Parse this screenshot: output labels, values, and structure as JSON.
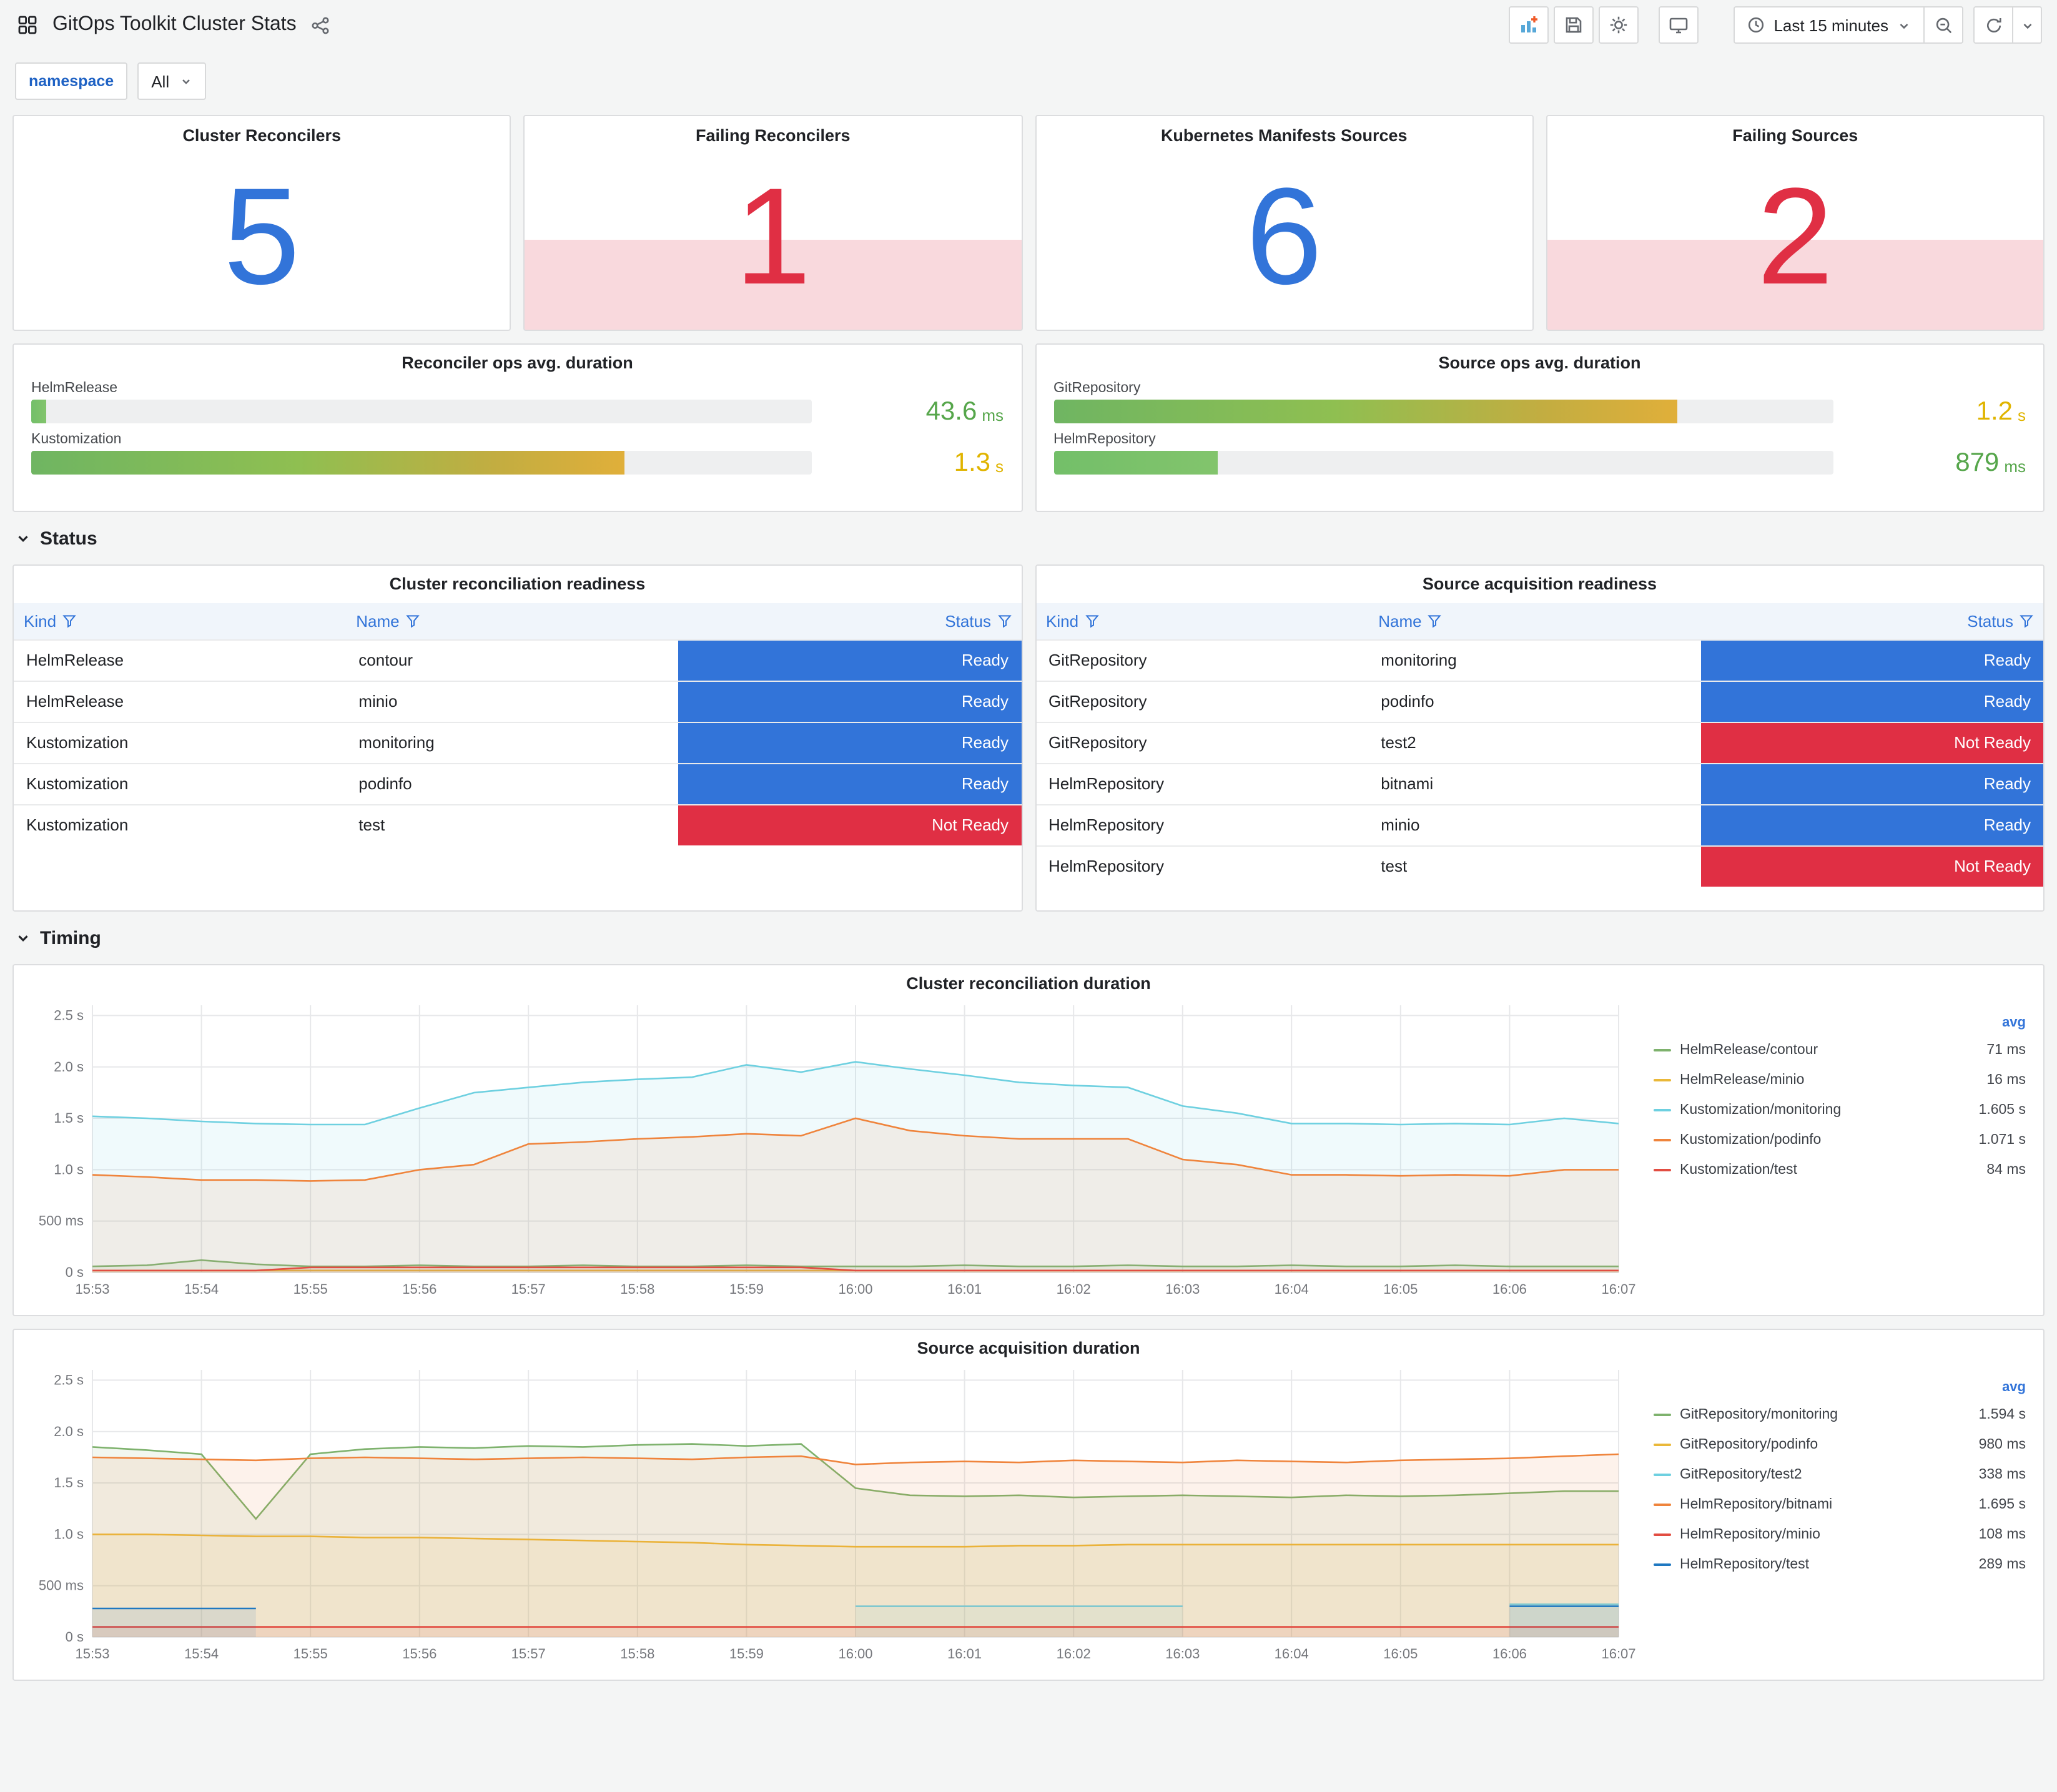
{
  "header": {
    "title": "GitOps Toolkit Cluster Stats",
    "time_picker": "Last 15 minutes"
  },
  "variables": {
    "label": "namespace",
    "value": "All"
  },
  "icons": [
    "dashboard-grid",
    "share",
    "add-panel",
    "save",
    "settings-gear",
    "cycle-view",
    "clock",
    "caret-down",
    "zoom-out",
    "refresh",
    "filter-funnel",
    "chevron-down"
  ],
  "colors": {
    "accent_blue": "#3274D9",
    "alert_red": "#E02F44",
    "value_green": "#56A64B",
    "value_yellow": "#E0B400"
  },
  "stat_panels": [
    {
      "title": "Cluster Reconcilers",
      "value": "5",
      "failing": false
    },
    {
      "title": "Failing Reconcilers",
      "value": "1",
      "failing": true
    },
    {
      "title": "Kubernetes Manifests Sources",
      "value": "6",
      "failing": false
    },
    {
      "title": "Failing Sources",
      "value": "2",
      "failing": true
    }
  ],
  "gauge_panels": [
    {
      "title": "Reconciler ops avg. duration",
      "rows": [
        {
          "label": "HelmRelease",
          "value": "43.6",
          "unit": "ms",
          "percent": 2,
          "fill": "green",
          "value_color": "#56A64B"
        },
        {
          "label": "Kustomization",
          "value": "1.3",
          "unit": "s",
          "percent": 76,
          "fill": "gradient",
          "value_color": "#E0B400"
        }
      ]
    },
    {
      "title": "Source ops avg. duration",
      "rows": [
        {
          "label": "GitRepository",
          "value": "1.2",
          "unit": "s",
          "percent": 80,
          "fill": "gradient",
          "value_color": "#E0B400"
        },
        {
          "label": "HelmRepository",
          "value": "879",
          "unit": "ms",
          "percent": 21,
          "fill": "green",
          "value_color": "#56A64B"
        }
      ]
    }
  ],
  "sections": [
    {
      "title": "Status"
    },
    {
      "title": "Timing"
    }
  ],
  "table_panels": [
    {
      "title": "Cluster reconciliation readiness",
      "columns": [
        "Kind",
        "Name",
        "Status"
      ],
      "rows": [
        [
          "HelmRelease",
          "contour",
          "Ready"
        ],
        [
          "HelmRelease",
          "minio",
          "Ready"
        ],
        [
          "Kustomization",
          "monitoring",
          "Ready"
        ],
        [
          "Kustomization",
          "podinfo",
          "Ready"
        ],
        [
          "Kustomization",
          "test",
          "Not Ready"
        ]
      ]
    },
    {
      "title": "Source acquisition readiness",
      "columns": [
        "Kind",
        "Name",
        "Status"
      ],
      "rows": [
        [
          "GitRepository",
          "monitoring",
          "Ready"
        ],
        [
          "GitRepository",
          "podinfo",
          "Ready"
        ],
        [
          "GitRepository",
          "test2",
          "Not Ready"
        ],
        [
          "HelmRepository",
          "bitnami",
          "Ready"
        ],
        [
          "HelmRepository",
          "minio",
          "Ready"
        ],
        [
          "HelmRepository",
          "test",
          "Not Ready"
        ]
      ]
    }
  ],
  "chart_data": [
    {
      "type": "line",
      "title": "Cluster reconciliation duration",
      "legend_header": "avg",
      "ylim": [
        0,
        2.6
      ],
      "yticks": [
        {
          "v": 0,
          "label": "0 s"
        },
        {
          "v": 0.5,
          "label": "500 ms"
        },
        {
          "v": 1,
          "label": "1.0 s"
        },
        {
          "v": 1.5,
          "label": "1.5 s"
        },
        {
          "v": 2,
          "label": "2.0 s"
        },
        {
          "v": 2.5,
          "label": "2.5 s"
        }
      ],
      "xticks": [
        "15:53",
        "15:54",
        "15:55",
        "15:56",
        "15:57",
        "15:58",
        "15:59",
        "16:00",
        "16:01",
        "16:02",
        "16:03",
        "16:04",
        "16:05",
        "16:06",
        "16:07"
      ],
      "points_per_minute": 2,
      "series": [
        {
          "name": "HelmRelease/contour",
          "color": "#7EB26D",
          "avg": "71 ms",
          "values": [
            0.06,
            0.07,
            0.12,
            0.08,
            0.06,
            0.06,
            0.07,
            0.06,
            0.06,
            0.07,
            0.06,
            0.06,
            0.07,
            0.06,
            0.06,
            0.06,
            0.07,
            0.06,
            0.06,
            0.07,
            0.06,
            0.06,
            0.07,
            0.06,
            0.06,
            0.07,
            0.06,
            0.06,
            0.06
          ]
        },
        {
          "name": "HelmRelease/minio",
          "color": "#EAB839",
          "avg": "16 ms",
          "values": [
            0.02,
            0.02,
            0.02,
            0.02,
            0.02,
            0.02,
            0.02,
            0.02,
            0.02,
            0.02,
            0.02,
            0.02,
            0.02,
            0.02,
            0.02,
            0.02,
            0.02,
            0.02,
            0.02,
            0.02,
            0.02,
            0.02,
            0.02,
            0.02,
            0.02,
            0.02,
            0.02,
            0.02,
            0.02
          ]
        },
        {
          "name": "Kustomization/monitoring",
          "color": "#6ED0E0",
          "avg": "1.605 s",
          "values": [
            1.52,
            1.5,
            1.47,
            1.45,
            1.44,
            1.44,
            1.6,
            1.75,
            1.8,
            1.85,
            1.88,
            1.9,
            2.02,
            1.95,
            2.05,
            1.98,
            1.92,
            1.85,
            1.82,
            1.8,
            1.62,
            1.55,
            1.45,
            1.45,
            1.44,
            1.45,
            1.44,
            1.5,
            1.45
          ]
        },
        {
          "name": "Kustomization/podinfo",
          "color": "#EF843C",
          "avg": "1.071 s",
          "values": [
            0.95,
            0.93,
            0.9,
            0.9,
            0.89,
            0.9,
            1.0,
            1.05,
            1.25,
            1.27,
            1.3,
            1.32,
            1.35,
            1.33,
            1.5,
            1.38,
            1.33,
            1.3,
            1.3,
            1.3,
            1.1,
            1.05,
            0.95,
            0.95,
            0.94,
            0.95,
            0.94,
            1.0,
            1.0
          ]
        },
        {
          "name": "Kustomization/test",
          "color": "#E24D42",
          "avg": "84 ms",
          "values": [
            0.02,
            0.02,
            0.02,
            0.02,
            0.05,
            0.05,
            0.05,
            0.05,
            0.05,
            0.05,
            0.05,
            0.05,
            0.05,
            0.05,
            0.02,
            0.02,
            0.02,
            0.02,
            0.02,
            0.02,
            0.02,
            0.02,
            0.02,
            0.02,
            0.02,
            0.02,
            0.02,
            0.02,
            0.02
          ]
        }
      ]
    },
    {
      "type": "line",
      "title": "Source acquisition duration",
      "legend_header": "avg",
      "ylim": [
        0,
        2.6
      ],
      "yticks": [
        {
          "v": 0,
          "label": "0 s"
        },
        {
          "v": 0.5,
          "label": "500 ms"
        },
        {
          "v": 1,
          "label": "1.0 s"
        },
        {
          "v": 1.5,
          "label": "1.5 s"
        },
        {
          "v": 2,
          "label": "2.0 s"
        },
        {
          "v": 2.5,
          "label": "2.5 s"
        }
      ],
      "xticks": [
        "15:53",
        "15:54",
        "15:55",
        "15:56",
        "15:57",
        "15:58",
        "15:59",
        "16:00",
        "16:01",
        "16:02",
        "16:03",
        "16:04",
        "16:05",
        "16:06",
        "16:07"
      ],
      "points_per_minute": 2,
      "series": [
        {
          "name": "GitRepository/monitoring",
          "color": "#7EB26D",
          "avg": "1.594 s",
          "values": [
            1.85,
            1.82,
            1.78,
            1.15,
            1.78,
            1.83,
            1.85,
            1.84,
            1.86,
            1.85,
            1.87,
            1.88,
            1.86,
            1.88,
            1.45,
            1.38,
            1.37,
            1.38,
            1.36,
            1.37,
            1.38,
            1.37,
            1.36,
            1.38,
            1.37,
            1.38,
            1.4,
            1.42,
            1.42
          ]
        },
        {
          "name": "GitRepository/podinfo",
          "color": "#EAB839",
          "avg": "980 ms",
          "values": [
            1.0,
            1.0,
            0.99,
            0.98,
            0.98,
            0.97,
            0.97,
            0.96,
            0.95,
            0.94,
            0.93,
            0.92,
            0.9,
            0.89,
            0.88,
            0.88,
            0.88,
            0.89,
            0.89,
            0.9,
            0.9,
            0.9,
            0.9,
            0.9,
            0.9,
            0.9,
            0.9,
            0.9,
            0.9
          ]
        },
        {
          "name": "GitRepository/test2",
          "color": "#6ED0E0",
          "avg": "338 ms",
          "values": [
            null,
            null,
            null,
            null,
            null,
            null,
            null,
            null,
            null,
            null,
            null,
            null,
            null,
            null,
            0.3,
            0.3,
            0.3,
            0.3,
            0.3,
            0.3,
            0.3,
            null,
            null,
            null,
            null,
            null,
            0.32,
            0.32,
            0.32
          ]
        },
        {
          "name": "HelmRepository/bitnami",
          "color": "#EF843C",
          "avg": "1.695 s",
          "values": [
            1.75,
            1.74,
            1.73,
            1.72,
            1.74,
            1.75,
            1.74,
            1.73,
            1.74,
            1.75,
            1.74,
            1.73,
            1.75,
            1.76,
            1.68,
            1.7,
            1.71,
            1.7,
            1.72,
            1.71,
            1.7,
            1.72,
            1.71,
            1.7,
            1.72,
            1.73,
            1.74,
            1.76,
            1.78
          ]
        },
        {
          "name": "HelmRepository/minio",
          "color": "#E24D42",
          "avg": "108 ms",
          "values": [
            0.1,
            0.1,
            0.1,
            0.1,
            0.1,
            0.1,
            0.1,
            0.1,
            0.1,
            0.1,
            0.1,
            0.1,
            0.1,
            0.1,
            0.1,
            0.1,
            0.1,
            0.1,
            0.1,
            0.1,
            0.1,
            0.1,
            0.1,
            0.1,
            0.1,
            0.1,
            0.1,
            0.1,
            0.1
          ]
        },
        {
          "name": "HelmRepository/test",
          "color": "#1F78C1",
          "avg": "289 ms",
          "values": [
            0.28,
            0.28,
            0.28,
            0.28,
            null,
            null,
            null,
            null,
            null,
            null,
            null,
            null,
            null,
            null,
            null,
            null,
            null,
            null,
            null,
            null,
            null,
            null,
            null,
            null,
            null,
            null,
            0.3,
            0.3,
            0.3
          ]
        }
      ]
    }
  ]
}
